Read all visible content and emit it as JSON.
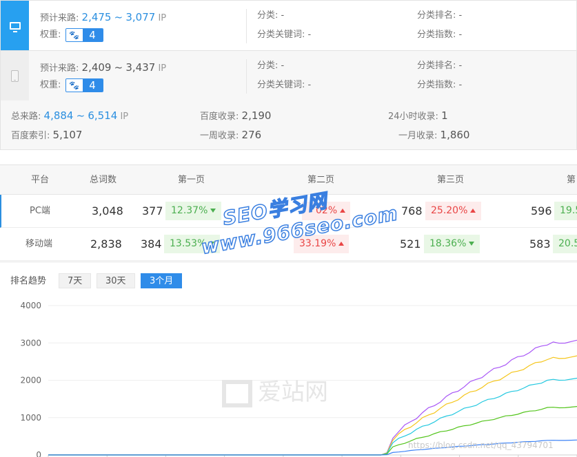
{
  "pc": {
    "traffic_label": "预计来路:",
    "traffic_low": "2,475",
    "traffic_sep": "~",
    "traffic_high": "3,077",
    "ip": "IP",
    "weight_label": "权重:",
    "weight_value": "4",
    "category_label": "分类:",
    "category_value": "-",
    "category_kw_label": "分类关键词:",
    "category_kw_value": "-",
    "category_rank_label": "分类排名:",
    "category_rank_value": "-",
    "category_index_label": "分类指数:",
    "category_index_value": "-"
  },
  "mobile": {
    "traffic_label": "预计来路:",
    "traffic_low": "2,409",
    "traffic_sep": "~",
    "traffic_high": "3,437",
    "ip": "IP",
    "weight_label": "权重:",
    "weight_value": "4",
    "category_label": "分类:",
    "category_value": "-",
    "category_kw_label": "分类关键词:",
    "category_kw_value": "-",
    "category_rank_label": "分类排名:",
    "category_rank_value": "-",
    "category_index_label": "分类指数:",
    "category_index_value": "-"
  },
  "totals": {
    "total_traffic_label": "总来路:",
    "total_traffic_low": "4,884",
    "total_traffic_sep": "~",
    "total_traffic_high": "6,514",
    "ip": "IP",
    "baidu_index_label": "百度收录:",
    "baidu_index_value": "2,190",
    "day_index_label": "24小时收录:",
    "day_index_value": "1",
    "baidu_search_label": "百度索引:",
    "baidu_search_value": "5,107",
    "week_index_label": "一周收录:",
    "week_index_value": "276",
    "month_index_label": "一月收录:",
    "month_index_value": "1,860"
  },
  "table": {
    "headers": [
      "平台",
      "总词数",
      "第一页",
      "第二页",
      "第三页",
      "第"
    ],
    "rows": [
      {
        "platform": "PC端",
        "total": "3,048",
        "p1_count": "377",
        "p1_pct": "12.37%",
        "p2_pct": "02%",
        "p3_count": "768",
        "p3_pct": "25.20%",
        "p4_count": "596",
        "p4_pct": "19.5"
      },
      {
        "platform": "移动端",
        "total": "2,838",
        "p1_count": "384",
        "p1_pct": "13.53%",
        "p2_pct": "33.19%",
        "p3_count": "521",
        "p3_pct": "18.36%",
        "p4_count": "583",
        "p4_pct": "20.5"
      }
    ]
  },
  "trend": {
    "title": "排名趋势",
    "buttons": [
      "7天",
      "30天",
      "3个月"
    ],
    "active": "3个月"
  },
  "watermarks": {
    "seo": "SEO学习网",
    "url": "www.966seo.com",
    "aizhan": "爱站网",
    "csdn": "https://blog.csdn.net/qq_43794701"
  },
  "colors": {
    "accent": "#2f8ce9",
    "green": "#4caf50",
    "red": "#e94545"
  },
  "chart_data": {
    "type": "line",
    "y_ticks": [
      "4000",
      "3000",
      "2000",
      "1000",
      "0"
    ],
    "ylim": [
      0,
      4000
    ],
    "x_count": 90,
    "series": [
      {
        "color": "#a855f7",
        "start": 57,
        "final": 3080
      },
      {
        "color": "#f5c518",
        "start": 57,
        "final": 2660
      },
      {
        "color": "#22c8e0",
        "start": 57,
        "final": 2060
      },
      {
        "color": "#52c41a",
        "start": 57,
        "final": 1300
      },
      {
        "color": "#3b82f6",
        "start": 57,
        "final": 400
      }
    ]
  }
}
